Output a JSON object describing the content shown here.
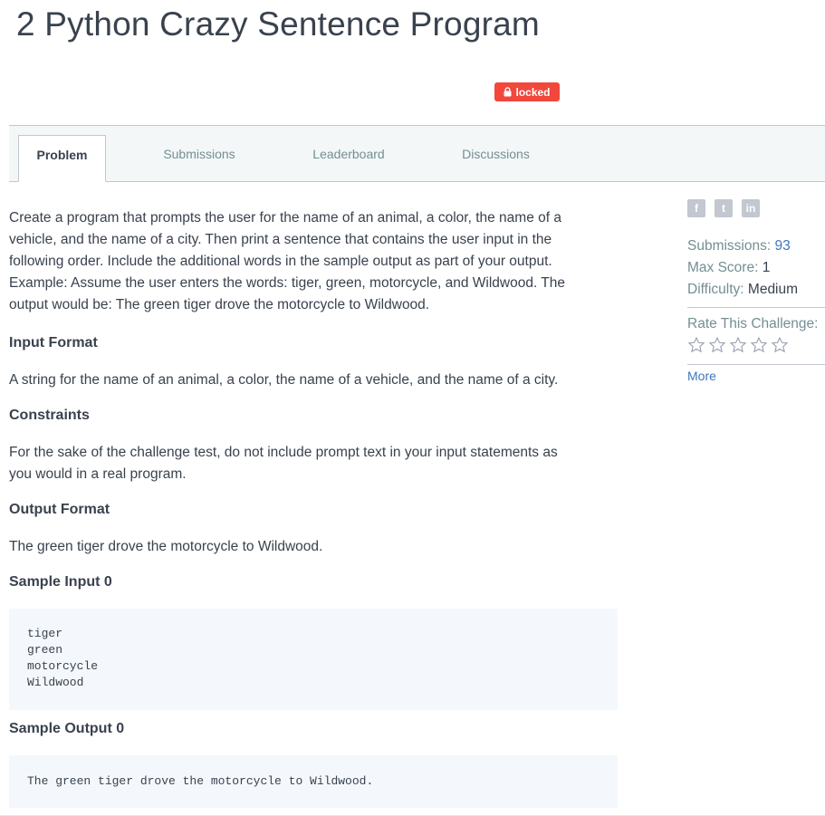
{
  "page": {
    "title": "2 Python Crazy Sentence Program",
    "badge": "locked"
  },
  "tabs": [
    "Problem",
    "Submissions",
    "Leaderboard",
    "Discussions"
  ],
  "problem": {
    "description_lines": [
      "Create a program that prompts the user for the name of an animal, a color, the name of a",
      "vehicle, and the name of a city. Then print a sentence that contains the user input in the",
      "following order. Include the additional words in the sample output as part of your output.",
      "Example: Assume the user enters the words: tiger, green, motorcycle, and Wildwood. The",
      "output would be: The green tiger drove the motorcycle to Wildwood."
    ],
    "input_format_heading": "Input Format",
    "input_format": "A string for the name of an animal, a color, the name of a vehicle, and the name of a city.",
    "constraints_heading": "Constraints",
    "constraints_lines": [
      "For the sake of the challenge test, do not include prompt text in your input statements as",
      "you would in a real program."
    ],
    "output_format_heading": "Output Format",
    "output_format": "The green tiger drove the motorcycle to Wildwood.",
    "sample_input_heading": "Sample Input 0",
    "sample_input": [
      "tiger",
      "green",
      "motorcycle",
      "Wildwood"
    ],
    "sample_output_heading": "Sample Output 0",
    "sample_output": "The green tiger drove the motorcycle to Wildwood."
  },
  "sidebar": {
    "social": [
      "f",
      "t",
      "in"
    ],
    "social_icons": [
      "facebook-icon",
      "twitter-icon",
      "linkedin-icon"
    ],
    "submissions_label": "Submissions:",
    "submissions_value": "93",
    "max_score_label": "Max Score:",
    "max_score_value": "1",
    "difficulty_label": "Difficulty:",
    "difficulty_value": "Medium",
    "rate_label": "Rate This Challenge:",
    "rating": 0,
    "stars_total": 5,
    "more": "More"
  },
  "colors": {
    "badge": "#f1483b",
    "link": "#3e77bd",
    "code_bg": "#f4f8fd"
  }
}
